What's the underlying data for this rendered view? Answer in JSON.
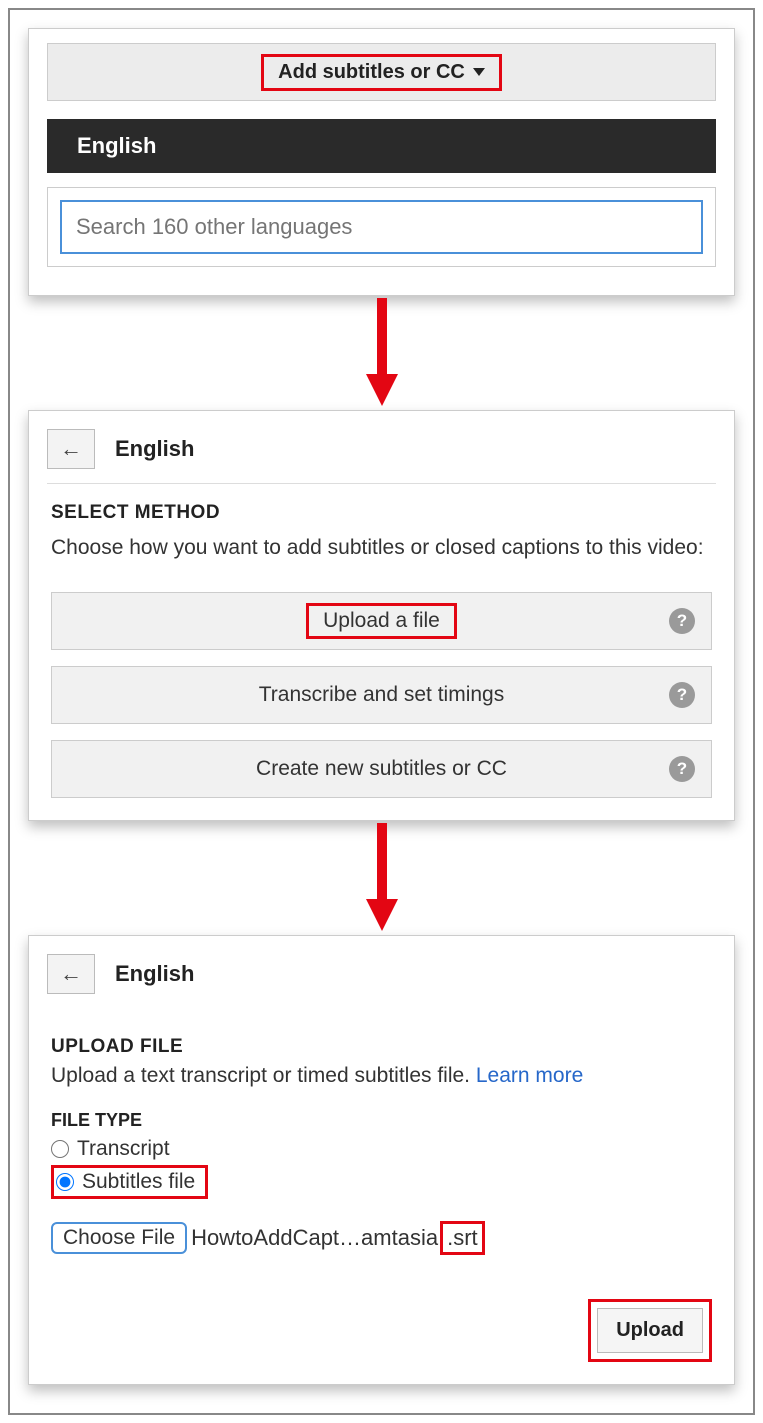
{
  "panel1": {
    "dropdown_label": "Add subtitles or CC",
    "selected_language": "English",
    "search_placeholder": "Search 160 other languages"
  },
  "panel2": {
    "language": "English",
    "section_title": "SELECT METHOD",
    "section_desc": "Choose how you want to add subtitles or closed captions to this video:",
    "methods": {
      "upload": "Upload a file",
      "transcribe": "Transcribe and set timings",
      "create": "Create new subtitles or CC"
    }
  },
  "panel3": {
    "language": "English",
    "section_title": "UPLOAD FILE",
    "section_desc": "Upload a text transcript or timed subtitles file. ",
    "learn_more": "Learn more",
    "file_type_title": "FILE TYPE",
    "radio_transcript": "Transcript",
    "radio_subtitles": "Subtitles file",
    "choose_file_label": "Choose File",
    "file_name_part": "HowtoAddCapt…amtasia",
    "file_ext": ".srt",
    "upload_label": "Upload"
  },
  "colors": {
    "highlight_red": "#e30613",
    "link_blue": "#2667c9"
  }
}
